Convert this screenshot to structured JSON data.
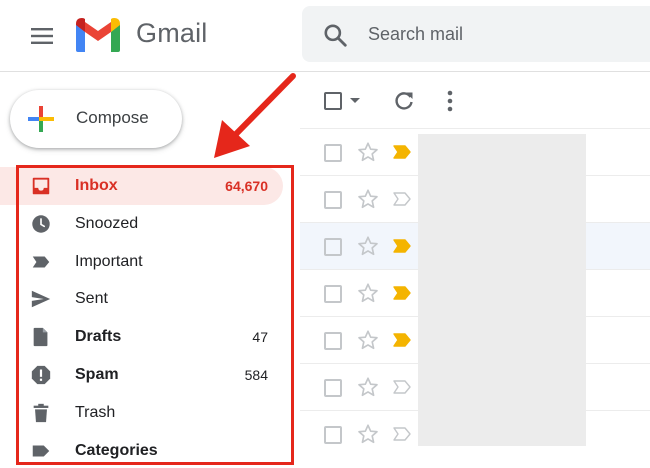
{
  "app": {
    "name": "Gmail",
    "search_placeholder": "Search mail"
  },
  "colors": {
    "accent_red": "#d93025",
    "active_bg": "#fce8e6",
    "important_yellow": "#f4b400",
    "annotation_red": "#e5271b"
  },
  "compose": {
    "label": "Compose"
  },
  "nav": [
    {
      "label": "Inbox",
      "icon": "inbox-icon",
      "count": "64,670",
      "active": true
    },
    {
      "label": "Snoozed",
      "icon": "clock-icon",
      "count": ""
    },
    {
      "label": "Important",
      "icon": "important-icon",
      "count": ""
    },
    {
      "label": "Sent",
      "icon": "send-icon",
      "count": ""
    },
    {
      "label": "Drafts",
      "icon": "draft-icon",
      "count": "47",
      "bold": true
    },
    {
      "label": "Spam",
      "icon": "spam-icon",
      "count": "584",
      "bold": true
    },
    {
      "label": "Trash",
      "icon": "trash-icon",
      "count": ""
    },
    {
      "label": "Categories",
      "icon": "label-icon",
      "count": "",
      "bold": true
    }
  ],
  "toolbar": {
    "select_icon": "checkbox-icon",
    "refresh_icon": "refresh-icon",
    "more_icon": "more-vert-icon"
  },
  "emails": [
    {
      "important": true,
      "read": false
    },
    {
      "important": false,
      "read": false
    },
    {
      "important": true,
      "read": true
    },
    {
      "important": true,
      "read": false
    },
    {
      "important": true,
      "read": false
    },
    {
      "important": false,
      "read": false
    },
    {
      "important": false,
      "read": false
    }
  ]
}
